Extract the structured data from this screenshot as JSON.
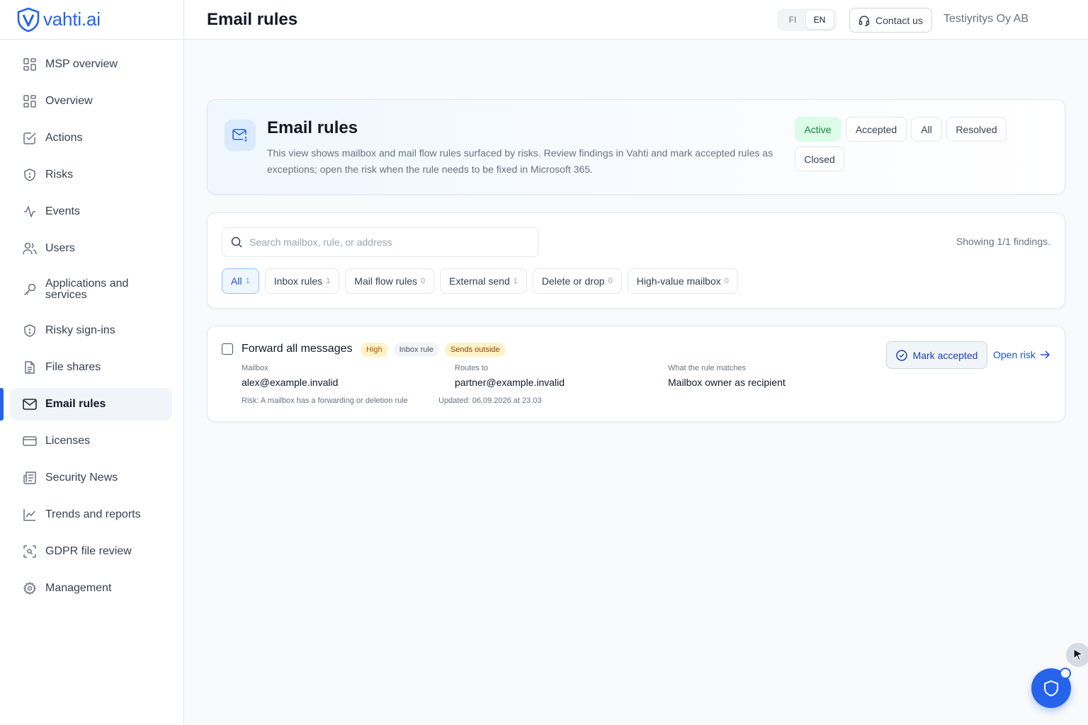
{
  "brand": {
    "name": "vahti.ai",
    "color": "#2563eb"
  },
  "sidebar": {
    "items": [
      {
        "label": "MSP overview",
        "icon": "grid-icon"
      },
      {
        "label": "Overview",
        "icon": "grid-icon"
      },
      {
        "label": "Actions",
        "icon": "checkbox-icon"
      },
      {
        "label": "Risks",
        "icon": "shield-icon"
      },
      {
        "label": "Events",
        "icon": "activity-icon"
      },
      {
        "label": "Users",
        "icon": "users-icon"
      },
      {
        "label": "Applications and services",
        "icon": "key-icon"
      },
      {
        "label": "Risky sign-ins",
        "icon": "shield-icon"
      },
      {
        "label": "File shares",
        "icon": "file-icon"
      },
      {
        "label": "Email rules",
        "icon": "mail-icon",
        "active": true
      },
      {
        "label": "Licenses",
        "icon": "credit-card-icon"
      },
      {
        "label": "Security News",
        "icon": "newspaper-icon"
      },
      {
        "label": "Trends and reports",
        "icon": "chart-line-icon"
      },
      {
        "label": "GDPR file review",
        "icon": "scan-icon"
      },
      {
        "label": "Management",
        "icon": "gear-icon"
      }
    ]
  },
  "header": {
    "title": "Email rules",
    "languages": [
      "FI",
      "EN"
    ],
    "selected_language": "EN",
    "contact_label": "Contact us",
    "organization": "Testiyritys Oy AB"
  },
  "hero": {
    "title": "Email rules",
    "description": "This view shows mailbox and mail flow rules surfaced by risks. Review findings in Vahti and mark accepted rules as exceptions; open the risk when the rule needs to be fixed in Microsoft 365.",
    "states": [
      "Active",
      "Accepted",
      "All",
      "Resolved",
      "Closed"
    ],
    "selected_state": "Active"
  },
  "filters": {
    "search_placeholder": "Search mailbox, rule, or address",
    "showing": "Showing 1/1 findings.",
    "chips": [
      {
        "label": "All",
        "count": "1",
        "active": true
      },
      {
        "label": "Inbox rules",
        "count": "1"
      },
      {
        "label": "Mail flow rules",
        "count": "0"
      },
      {
        "label": "External send",
        "count": "1"
      },
      {
        "label": "Delete or drop",
        "count": "0"
      },
      {
        "label": "High-value mailbox",
        "count": "0"
      }
    ]
  },
  "finding": {
    "title": "Forward all messages",
    "tags": [
      "High",
      "Inbox rule",
      "Sends outside"
    ],
    "mailbox_label": "Mailbox",
    "mailbox": "alex@example.invalid",
    "routes_label": "Routes to",
    "routes": "partner@example.invalid",
    "matches_label": "What the rule matches",
    "matches": "Mailbox owner as recipient",
    "risk": "Risk: A mailbox has a forwarding or deletion rule",
    "updated": "Updated: 06.09.2026 at 23.03",
    "mark_label": "Mark accepted",
    "open_label": "Open risk"
  },
  "colors": {
    "accent": "#2563eb",
    "active_state_bg": "#dcfce7",
    "active_state_text": "#15803d",
    "tag_high": "#fef3c7"
  }
}
